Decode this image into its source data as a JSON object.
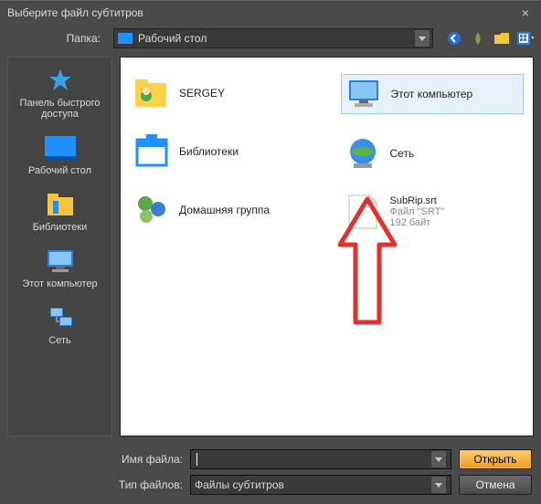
{
  "title": "Выберите файл субтитров",
  "folder": {
    "label": "Папка:",
    "value": "Рабочий стол"
  },
  "sidebar": {
    "items": [
      {
        "label": "Панель быстрого доступа"
      },
      {
        "label": "Рабочий стол"
      },
      {
        "label": "Библиотеки"
      },
      {
        "label": "Этот компьютер"
      },
      {
        "label": "Сеть"
      }
    ]
  },
  "files": {
    "left": [
      {
        "name": "SERGEY"
      },
      {
        "name": "Библиотеки"
      },
      {
        "name": "Домашняя группа"
      }
    ],
    "right": [
      {
        "name": "Этот компьютер"
      },
      {
        "name": "Сеть"
      },
      {
        "name": "SubRip.srt",
        "line2": "Файл \"SRT\"",
        "line3": "192 байт"
      }
    ]
  },
  "filename": {
    "label": "Имя файла:",
    "value": ""
  },
  "filetype": {
    "label": "Тип файлов:",
    "value": "Файлы субтитров"
  },
  "buttons": {
    "open": "Открыть",
    "cancel": "Отмена"
  }
}
